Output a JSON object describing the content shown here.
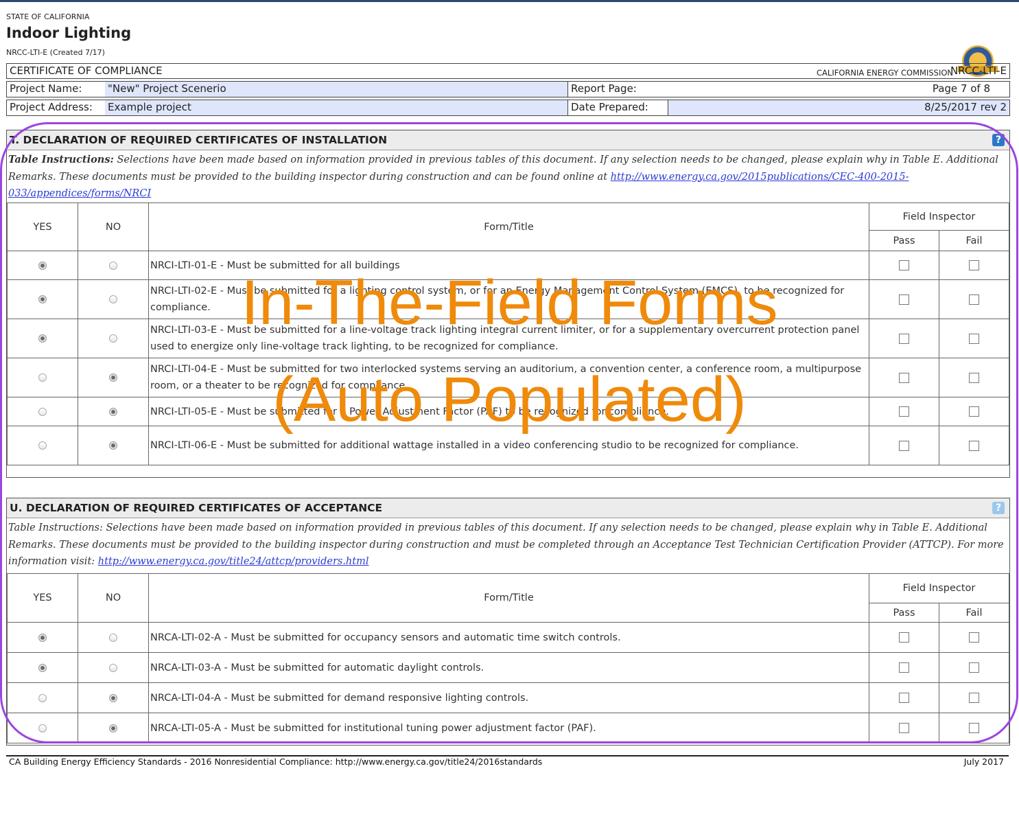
{
  "header": {
    "state": "STATE OF CALIFORNIA",
    "title": "Indoor Lighting",
    "form_created": "NRCC-LTI-E (Created 7/17)",
    "agency": "CALIFORNIA ENERGY COMMISSION"
  },
  "cert_bar": {
    "left": "CERTIFICATE OF COMPLIANCE",
    "right": "NRCC-LTI-E"
  },
  "project": {
    "name_label": "Project Name:",
    "name_value": "\"New\" Project Scenerio",
    "report_page_label": "Report Page:",
    "report_page_value": "Page 7 of 8",
    "address_label": "Project Address:",
    "address_value": "Example project",
    "date_label": "Date Prepared:",
    "date_value": "8/25/2017 rev 2"
  },
  "section_t": {
    "title": "T. DECLARATION OF REQUIRED CERTIFICATES OF INSTALLATION",
    "help": "?",
    "instructions_bold": "Table Instructions:",
    "instructions": " Selections have been made based on information provided in previous tables of this document. If any selection needs to be changed, please explain why in Table E. Additional Remarks. These documents must be provided to the building inspector during construction and can be found online at ",
    "link": "http://www.energy.ca.gov/2015publications/CEC-400-2015-033/appendices/forms/NRCI",
    "col_yes": "YES",
    "col_no": "NO",
    "col_form": "Form/Title",
    "col_inspector": "Field Inspector",
    "col_pass": "Pass",
    "col_fail": "Fail",
    "rows": [
      {
        "yes": true,
        "no": false,
        "text": "NRCI-LTI-01-E - Must be submitted for all buildings"
      },
      {
        "yes": true,
        "no": false,
        "text": "NRCI-LTI-02-E - Must be submitted for a lighting control system, or for an Energy Management Control System (EMCS), to be recognized for compliance."
      },
      {
        "yes": true,
        "no": false,
        "text": "NRCI-LTI-03-E - Must be submitted for a line-voltage track lighting integral current limiter, or for a supplementary overcurrent protection panel used to energize only line-voltage track lighting, to be recognized for compliance."
      },
      {
        "yes": false,
        "no": true,
        "text": "NRCI-LTI-04-E - Must be submitted for two interlocked systems serving an auditorium, a convention center, a conference room, a multipurpose room, or a theater to be recognized for compliance."
      },
      {
        "yes": false,
        "no": true,
        "text": "NRCI-LTI-05-E - Must be submitted for a Power Adjustment Factor (PAF) to be recognized for compliance."
      },
      {
        "yes": false,
        "no": true,
        "text": "NRCI-LTI-06-E - Must be submitted for additional wattage installed in a video conferencing studio to be recognized for compliance."
      }
    ]
  },
  "section_u": {
    "title": "U. DECLARATION OF REQUIRED CERTIFICATES OF ACCEPTANCE",
    "help": "?",
    "instructions_bold": "Table Instructions:",
    "instructions": " Selections have been made based on information provided in previous tables of this document. If any selection needs to be changed, please explain why in Table E. Additional Remarks. These documents must be provided to the building inspector during construction and must be completed through an Acceptance Test Technician Certification Provider (ATTCP).  For more information visit: ",
    "link": "http://www.energy.ca.gov/title24/attcp/providers.html",
    "col_yes": "YES",
    "col_no": "NO",
    "col_form": "Form/Title",
    "col_inspector": "Field Inspector",
    "col_pass": "Pass",
    "col_fail": "Fail",
    "rows": [
      {
        "yes": true,
        "no": false,
        "text": "NRCA-LTI-02-A - Must be submitted for occupancy sensors and automatic time switch controls."
      },
      {
        "yes": true,
        "no": false,
        "text": "NRCA-LTI-03-A - Must be submitted for automatic daylight controls."
      },
      {
        "yes": false,
        "no": true,
        "text": "NRCA-LTI-04-A - Must be submitted for demand responsive lighting controls."
      },
      {
        "yes": false,
        "no": true,
        "text": "NRCA-LTI-05-A - Must be submitted for institutional tuning power adjustment factor (PAF)."
      }
    ]
  },
  "overlay": {
    "line1": "In-The-Field Forms",
    "line2": "(Auto Populated)",
    "text_color": "#ef8a0a",
    "border_color": "#9b45e0"
  },
  "footer": {
    "left": "CA Building Energy Efficiency Standards - 2016 Nonresidential Compliance: http://www.energy.ca.gov/title24/2016standards",
    "right": "July 2017"
  }
}
